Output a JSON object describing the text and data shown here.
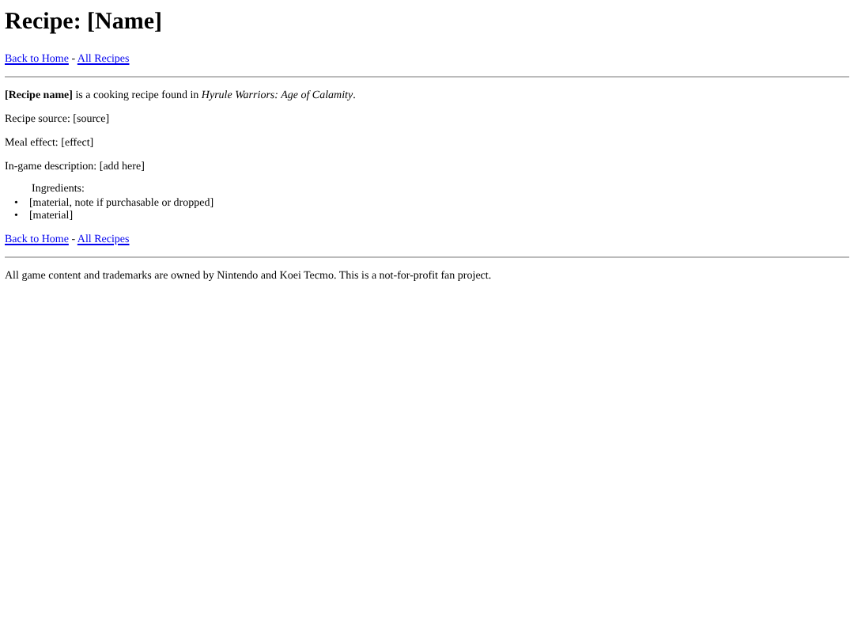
{
  "title": "Recipe: [Name]",
  "nav_top": {
    "links": [
      "Back to Home",
      "All Recipes"
    ],
    "separator": "-"
  },
  "intro": "**[Recipe name]** is a cooking recipe found in *Hyrule Warriors: Age of Calamity*.",
  "fields": [
    "Recipe source: [source]",
    "Meal effect: [effect]",
    "In-game description: [add here]"
  ],
  "ingredients": {
    "heading": "Ingredients:",
    "bullet": "•",
    "items": [
      "[material, note if purchasable or dropped]",
      "[material]"
    ]
  },
  "nav_bottom": {
    "links": [
      "Back to Home",
      "All Recipes"
    ],
    "separator": "-"
  },
  "footer": "All game content and trademarks are owned by Nintendo and Koei Tecmo. This is a not-for-profit fan project."
}
